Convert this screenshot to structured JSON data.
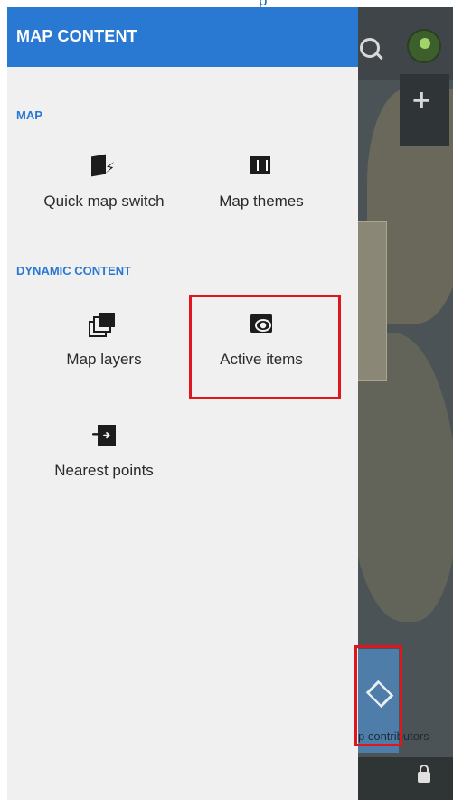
{
  "top_link": "p",
  "drawer": {
    "title": "MAP CONTENT",
    "sections": [
      {
        "title": "MAP",
        "items": [
          {
            "label": "Quick map switch",
            "icon": "quick-map-switch-icon"
          },
          {
            "label": "Map themes",
            "icon": "map-themes-icon"
          }
        ]
      },
      {
        "title": "DYNAMIC CONTENT",
        "items": [
          {
            "label": "Map layers",
            "icon": "map-layers-icon"
          },
          {
            "label": "Active items",
            "icon": "active-items-eye-icon"
          },
          {
            "label": "Nearest points",
            "icon": "nearest-points-icon"
          }
        ]
      }
    ]
  },
  "map": {
    "attribution": "p contributors",
    "icons": [
      "search-icon",
      "gps-icon",
      "zoom-in-icon",
      "layers-icon",
      "lock-icon"
    ]
  },
  "highlight_color": "#e0161e",
  "accent_color": "#2979d2"
}
